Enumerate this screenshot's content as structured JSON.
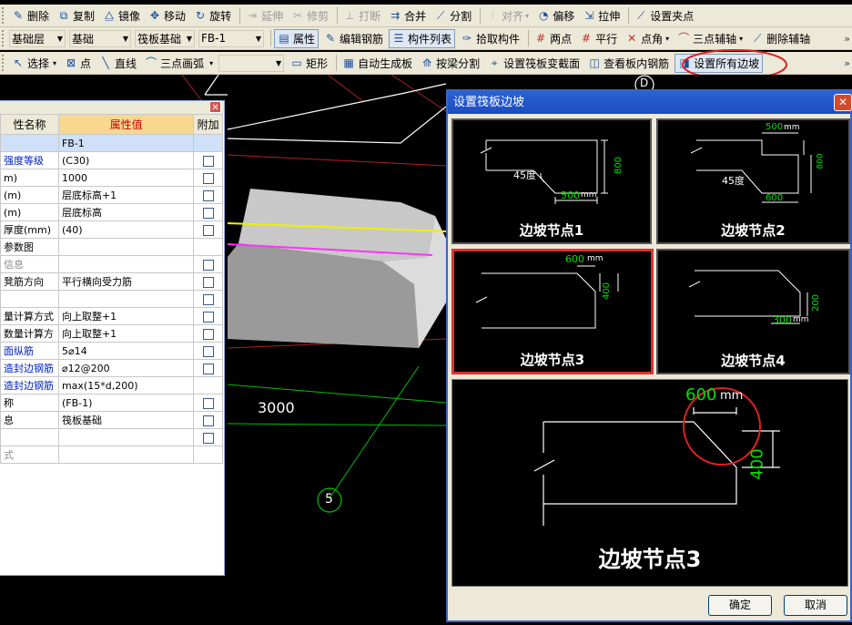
{
  "toolbar1": {
    "delete": "删除",
    "copy": "复制",
    "mirror": "镜像",
    "move": "移动",
    "rotate": "旋转",
    "extend": "延伸",
    "trim": "修剪",
    "break": "打断",
    "merge": "合并",
    "split": "分割",
    "align": "对齐",
    "offset": "偏移",
    "stretch": "拉伸",
    "set_grip": "设置夹点"
  },
  "toolbar2": {
    "layer": "基础层",
    "category": "基础",
    "type": "筏板基础",
    "component": "FB-1",
    "properties": "属性",
    "edit_rebar": "编辑钢筋",
    "component_list": "构件列表",
    "pick": "拾取构件",
    "two_point": "两点",
    "parallel": "平行",
    "point_angle": "点角",
    "three_point_axis": "三点辅轴",
    "delete_axis": "删除辅轴"
  },
  "toolbar3": {
    "select": "选择",
    "point": "点",
    "line": "直线",
    "arc": "三点画弧",
    "rect": "矩形",
    "auto_gen": "自动生成板",
    "split_by_beam": "按梁分割",
    "set_section": "设置筏板变截面",
    "view_rebar": "查看板内钢筋",
    "set_all_slopes": "设置所有边坡"
  },
  "viewport": {
    "dimension": "3000",
    "axis_label": "5",
    "axis_label_top": "D"
  },
  "property_panel": {
    "headers": [
      "性名称",
      "属性值",
      "附加"
    ],
    "rows": [
      {
        "name": "",
        "value": "FB-1",
        "style": "sel",
        "check": false
      },
      {
        "name": "强度等级",
        "value": "(C30)",
        "style": "blue",
        "check": true
      },
      {
        "name": "m)",
        "value": "1000",
        "style": "",
        "check": true
      },
      {
        "name": "(m)",
        "value": "层底标高+1",
        "style": "",
        "check": true
      },
      {
        "name": "(m)",
        "value": "层底标高",
        "style": "",
        "check": true
      },
      {
        "name": "厚度(mm)",
        "value": "(40)",
        "style": "",
        "check": true
      },
      {
        "name": "参数图",
        "value": "",
        "style": "",
        "check": false
      },
      {
        "name": "信息",
        "value": "",
        "style": "gray",
        "check": true
      },
      {
        "name": "凳筋方向",
        "value": "平行横向受力筋",
        "style": "",
        "check": true
      },
      {
        "name": "",
        "value": "",
        "style": "",
        "check": true
      },
      {
        "name": "量计算方式",
        "value": "向上取整+1",
        "style": "",
        "check": true
      },
      {
        "name": "数量计算方",
        "value": "向上取整+1",
        "style": "",
        "check": true
      },
      {
        "name": "面纵筋",
        "value": "5⌀14",
        "style": "blue",
        "check": true
      },
      {
        "name": "造封边钢筋",
        "value": "⌀12@200",
        "style": "blue",
        "check": true
      },
      {
        "name": "造封边钢筋",
        "value": "max(15*d,200)",
        "style": "blue",
        "check": false
      },
      {
        "name": "称",
        "value": "(FB-1)",
        "style": "",
        "check": true
      },
      {
        "name": "息",
        "value": "筏板基础",
        "style": "",
        "check": true
      },
      {
        "name": "",
        "value": "",
        "style": "",
        "check": true
      },
      {
        "name": "式",
        "value": "",
        "style": "gray",
        "check": false
      }
    ]
  },
  "dialog": {
    "title": "设置筏板边坡",
    "cards": [
      {
        "caption": "边坡节点1",
        "dim1": "45度",
        "dim2": "500",
        "dim3": "800",
        "unit": "mm"
      },
      {
        "caption": "边坡节点2",
        "dim1": "45度",
        "dim2": "500",
        "dim3": "800",
        "dim4": "600",
        "unit": "mm"
      },
      {
        "caption": "边坡节点3",
        "dim1": "600",
        "dim2": "400",
        "unit": "mm"
      },
      {
        "caption": "边坡节点4",
        "dim1": "300",
        "dim2": "200",
        "unit": "mm"
      }
    ],
    "preview": {
      "caption": "边坡节点3",
      "dim1": "600",
      "dim2": "400",
      "unit": "mm"
    },
    "ok": "确定",
    "cancel": "取消"
  },
  "colors": {
    "accent_red": "#e03030",
    "dim_green": "#00e000",
    "dialog_title": "#2c62d4"
  }
}
